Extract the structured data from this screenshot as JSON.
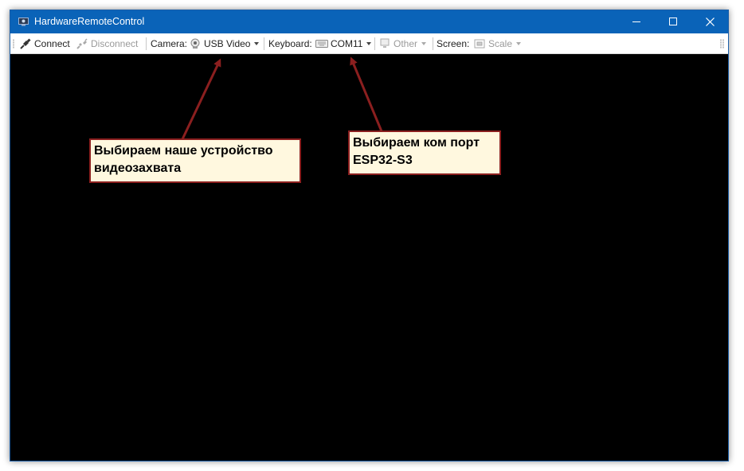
{
  "window": {
    "title": "HardwareRemoteControl"
  },
  "toolbar": {
    "connect_label": "Connect",
    "disconnect_label": "Disconnect",
    "camera_label": "Camera:",
    "camera_value": "USB Video",
    "keyboard_label": "Keyboard:",
    "keyboard_value": "COM11",
    "other_label": "Other",
    "screen_label": "Screen:",
    "scale_label": "Scale"
  },
  "annotations": {
    "camera_hint": "Выбираем наше устройство\nвидеозахвата",
    "port_hint": "Выбираем ком порт\nESP32-S3"
  },
  "colors": {
    "titlebar": "#0a63b8",
    "callout_border": "#8b1f1f",
    "callout_fill": "#fff8df",
    "arrow": "#8b1f1f"
  }
}
